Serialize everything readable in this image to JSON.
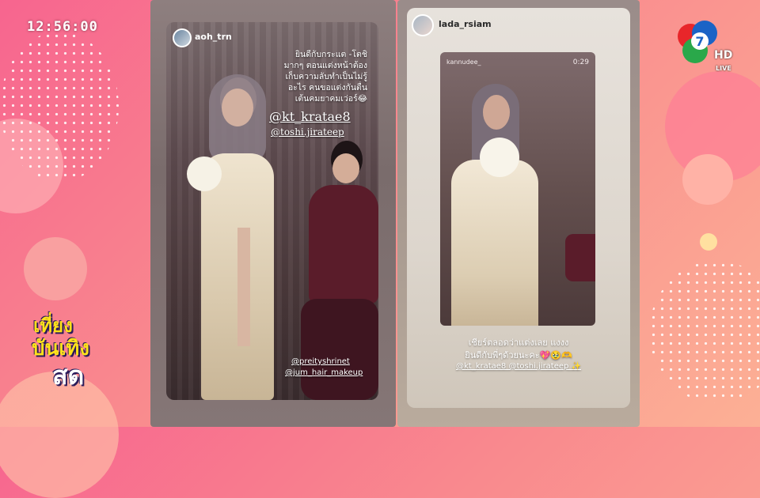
{
  "clock": {
    "time": "12:56:00"
  },
  "channel": {
    "number": "7",
    "hd_label": "HD",
    "live_label": "LIVE"
  },
  "show_logo": {
    "line1": "เที่ยง",
    "line2": "บันเทิง",
    "line3": "สด"
  },
  "story_left": {
    "username": "aoh_trn",
    "caption_lines": [
      "ยินดีกับกระแต -โตชิ",
      "มากๆ ตอนแต่งหน้าต้อง",
      "เก็บความลับทำเป็นไม่รู้",
      "อะไร คนขอแต่งกันตื่น",
      "เต้นคมยาคมเว่อร์😂"
    ],
    "tag1": "@kt_kratae8",
    "tag2": "@toshi.jirateep",
    "tag3": "@preityshrinet",
    "tag4": "@jum_hair_makeup"
  },
  "story_right": {
    "username": "lada_rsiam",
    "video_user": "kannudee_",
    "video_time": "0:29",
    "caption_line1": "เชียร์ตลอดว่าแต่งเลย แงงง",
    "caption_line2": "ยินดีกับพี่ๆด้วยนะคะ💖🥹🫶",
    "caption_line3": "@kt_kratae8 @toshi.jirateep ✨"
  },
  "colors": {
    "bg_pink": "#f7658f",
    "bg_peach": "#fcb095",
    "logo_yellow": "#ffe21a"
  }
}
